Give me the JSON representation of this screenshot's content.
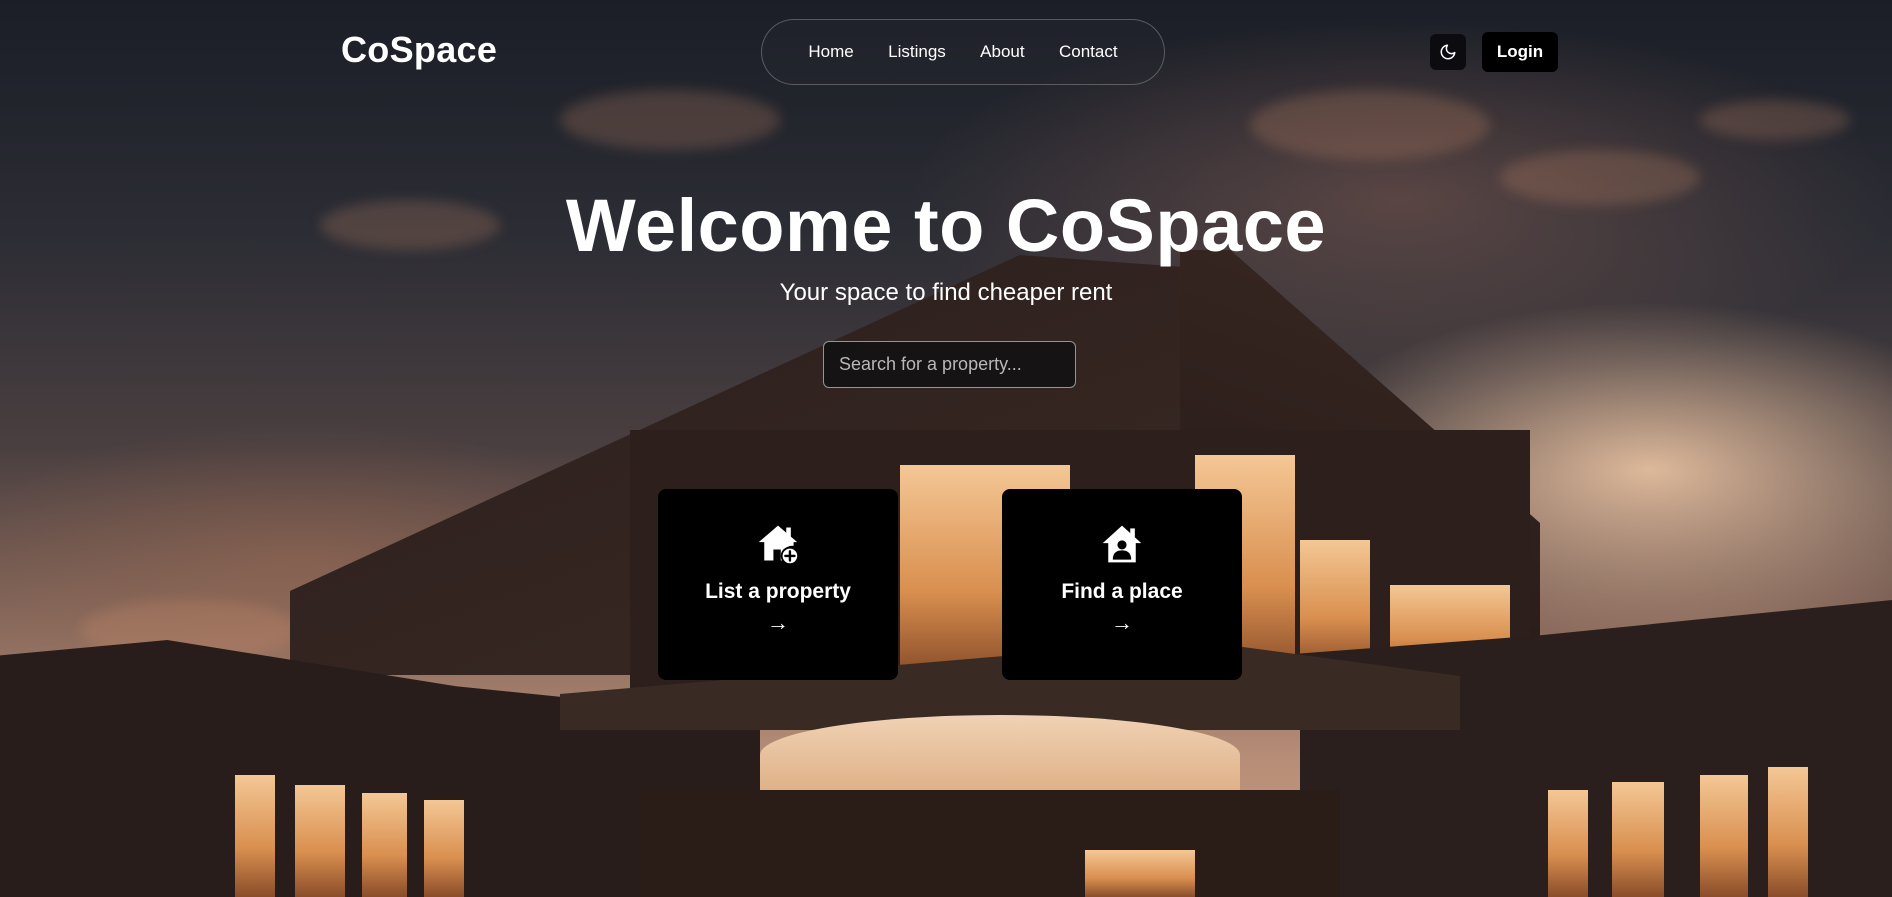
{
  "header": {
    "logo": "CoSpace",
    "nav": [
      "Home",
      "Listings",
      "About",
      "Contact"
    ],
    "theme_toggle_icon": "moon-icon",
    "login_label": "Login"
  },
  "hero": {
    "title": "Welcome to CoSpace",
    "subtitle": "Your space to find cheaper rent",
    "search_placeholder": "Search for a property..."
  },
  "cards": [
    {
      "title": "List a property",
      "arrow": "→",
      "icon": "house-plus-icon"
    },
    {
      "title": "Find a place",
      "arrow": "→",
      "icon": "house-user-icon"
    }
  ],
  "colors": {
    "card_background": "#000000",
    "text": "#ffffff",
    "button_background": "#000000"
  }
}
